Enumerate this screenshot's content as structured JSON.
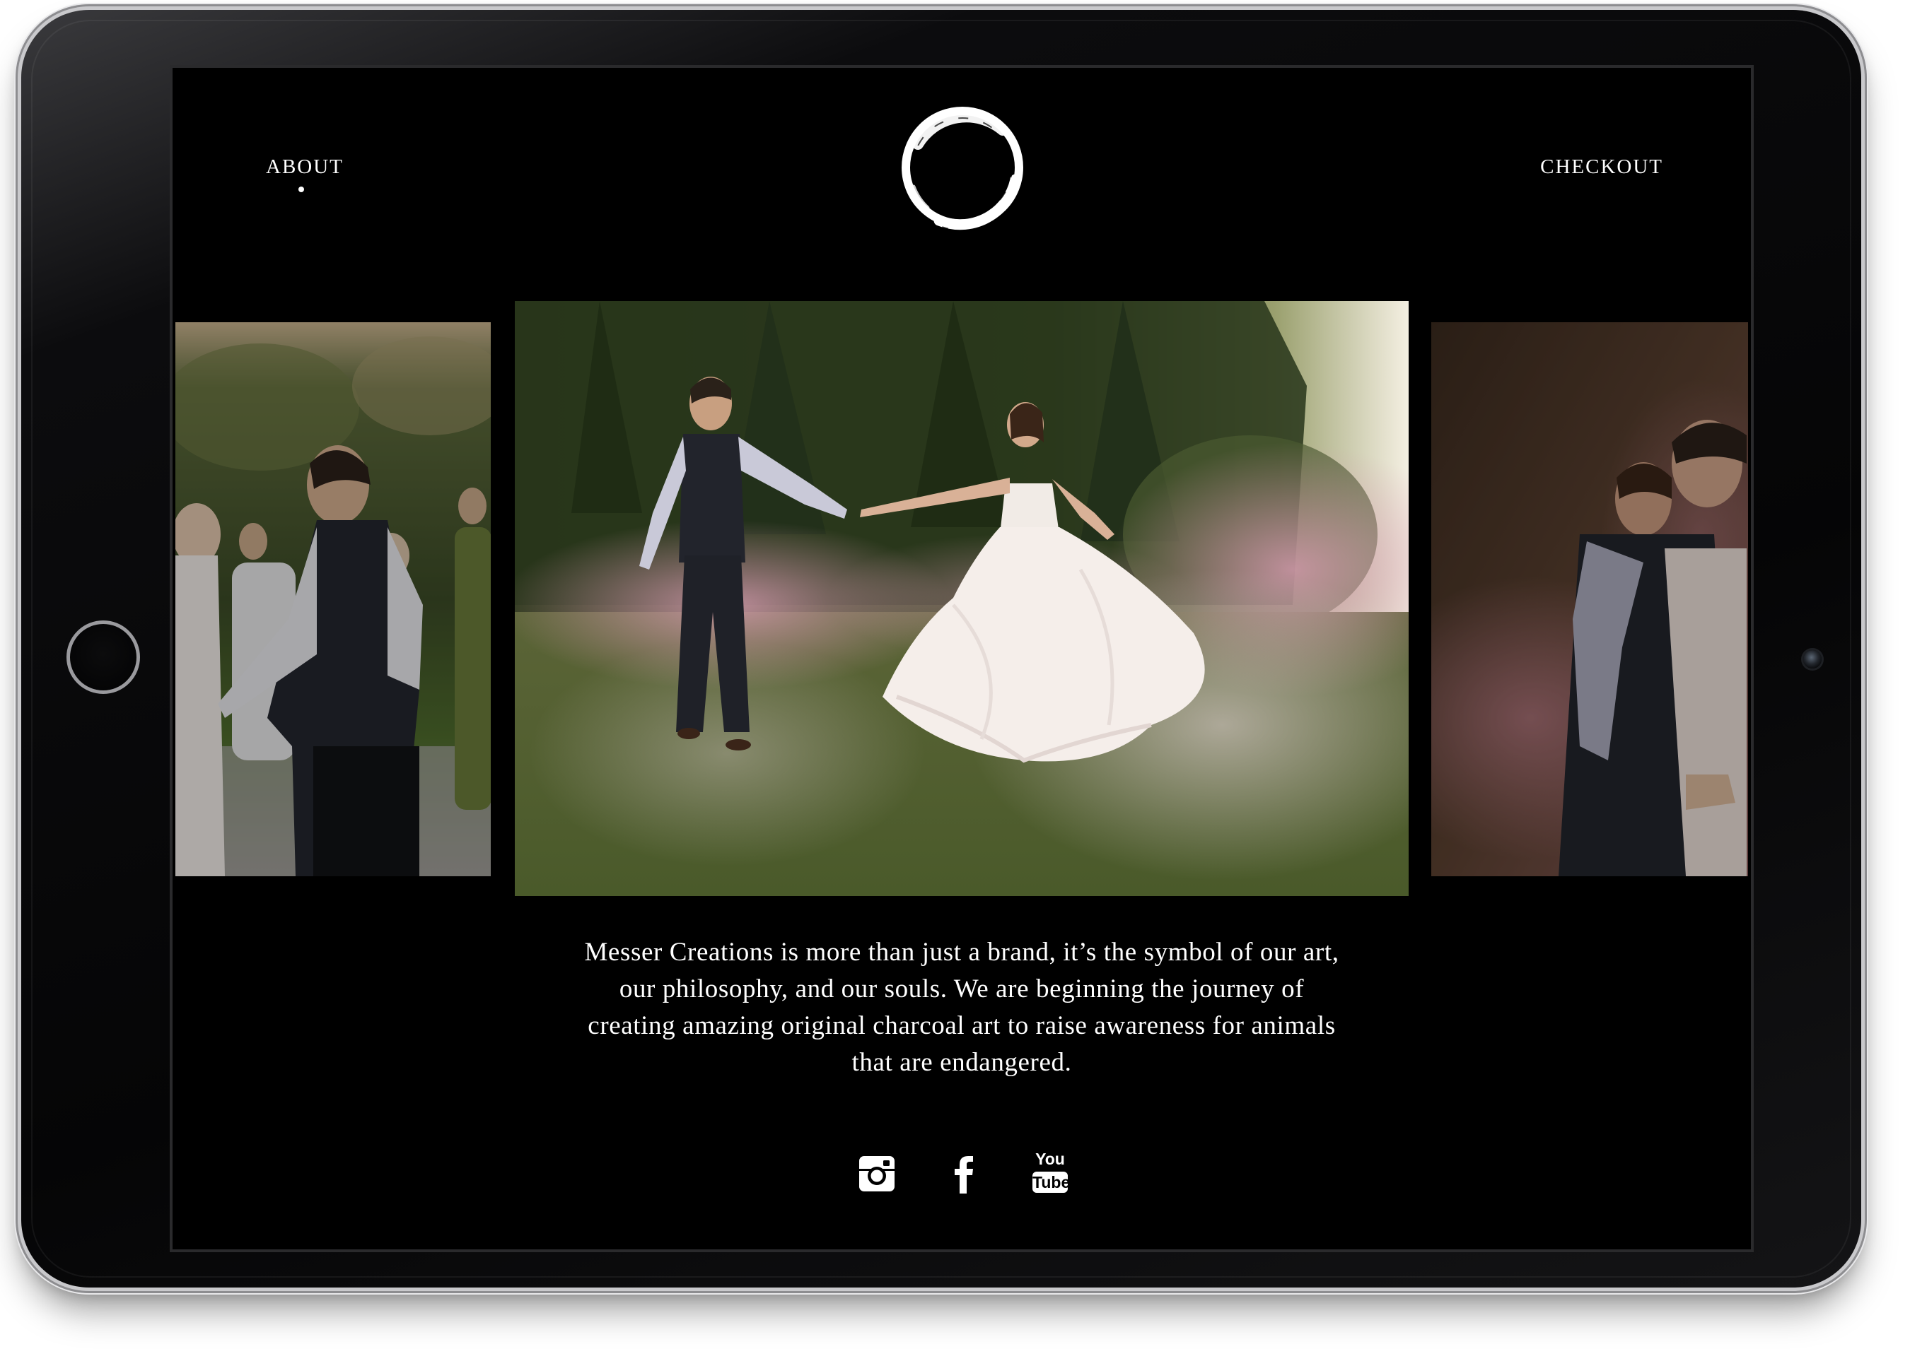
{
  "nav": {
    "about_label": "ABOUT",
    "checkout_label": "CHECKOUT",
    "active_item": "about"
  },
  "brand": {
    "logo_icon": "brush-circle-logo-icon"
  },
  "carousel": {
    "slides": [
      {
        "position": "previous",
        "subject": "groom-and-bride-dancing-at-reception"
      },
      {
        "position": "current",
        "subject": "groom-spinning-bride-on-lawn-with-pink-smoke"
      },
      {
        "position": "next",
        "subject": "couple-embracing-in-pink-smoke"
      }
    ]
  },
  "tagline": "Messer Creations is more than just a brand, it’s the symbol of our art, our philosophy, and our souls. We are beginning the journey of creating amazing original charcoal art to raise awareness for animals that are endangered.",
  "social": {
    "icons": [
      "instagram-icon",
      "facebook-icon",
      "youtube-icon"
    ],
    "youtube_top": "You",
    "youtube_bottom": "Tube"
  },
  "colors": {
    "background": "#000000",
    "text": "#ffffff",
    "smoke_pink": "#c58a9a",
    "grass_green": "#4f5a2e"
  }
}
